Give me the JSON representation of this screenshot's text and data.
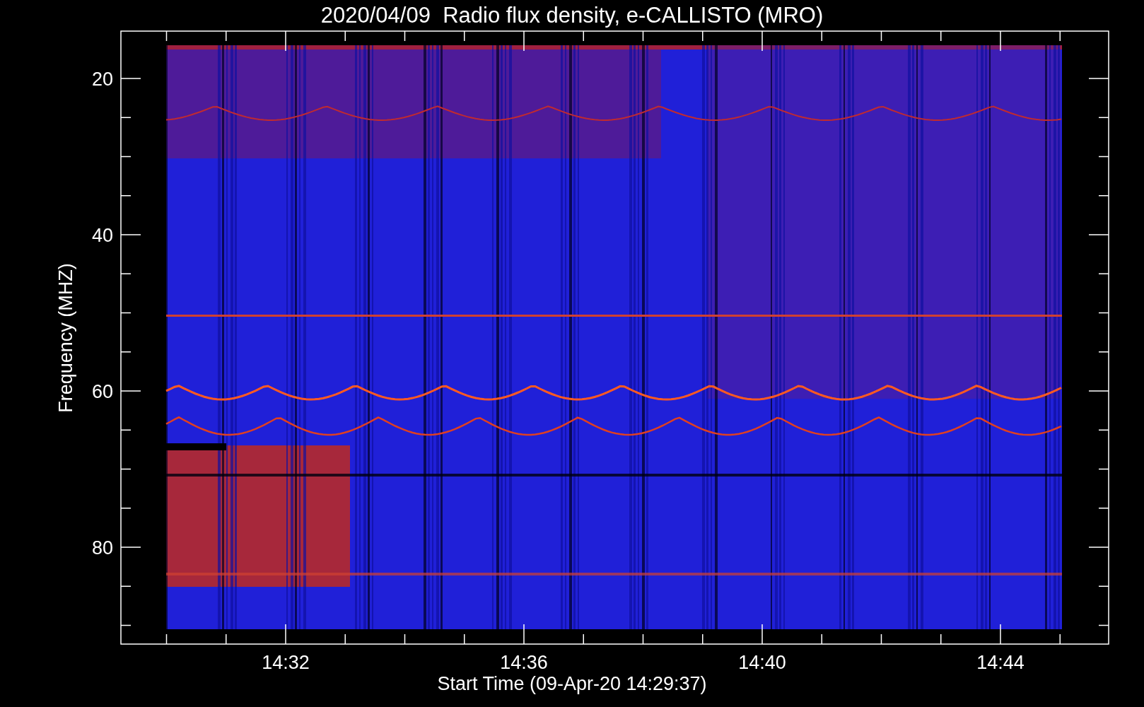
{
  "title": "2020/04/09  Radio flux density, e-CALLISTO (MRO)",
  "y_axis": {
    "label": "Frequency (MHZ)",
    "ticks": [
      "20",
      "40",
      "60",
      "80"
    ]
  },
  "x_axis": {
    "label": "Start Time (09-Apr-20 14:29:37)",
    "ticks": [
      "14:32",
      "14:36",
      "14:40",
      "14:44"
    ]
  }
}
